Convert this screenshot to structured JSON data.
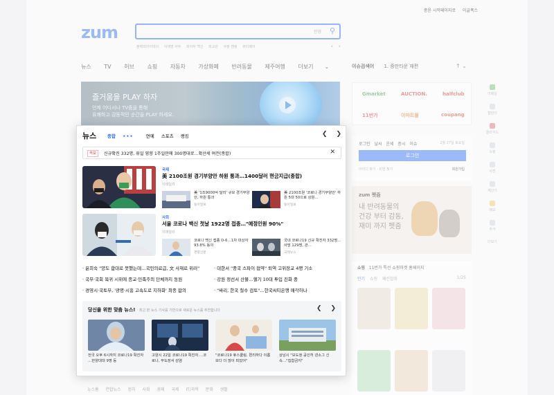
{
  "top_links": [
    "종윤 시작페이지로",
    "이글폭스"
  ],
  "logo": "zum",
  "search": {
    "value": "",
    "kbd": "한영"
  },
  "keywords": [
    "블랙프라이데이",
    "이재명 서부",
    "화이자 백신",
    "외교관",
    "쿠팡 캠핑",
    "뷰티페어"
  ],
  "menu": [
    "뉴스",
    "TV",
    "허브",
    "쇼핑",
    "자동차",
    "가상화폐",
    "반려동물",
    "제주여행",
    "더보기"
  ],
  "issue": {
    "label": "이슈검색어",
    "rank": "1.",
    "term": "중만타운 재편"
  },
  "banner": {
    "title": "즐거움을 PLAY 하자",
    "line1": "언제 어디서나 TV줌을 통해",
    "line2": "유쾌하고 감동적인 순간을 PLAY 하세요."
  },
  "news": {
    "title": "뉴스",
    "tabs": [
      "종합",
      "연예",
      "스포츠",
      "랭킹"
    ],
    "breaking": {
      "badge": "속보",
      "text": "신규확진 332명, 휴일 영향 1주일만에 300명대로…확산세 여전(종합)"
    },
    "stories": [
      {
        "category": "국제",
        "headline": "美 2100조원 경기부양안 하원 통과…1400달러 현금지급(종합)",
        "source": "이데일리",
        "subs": [
          {
            "title": "美 '1조9000억 달러' 규모 경기부양안, 하원 통과",
            "source": "동아일보"
          },
          {
            "title": "美 2100조원 '코로나 경기부양안' 하원 5대 50으로 상원…",
            "source": "동아일보"
          }
        ]
      },
      {
        "category": "사회",
        "headline": "서울 코로나 백신 첫날 1922명 접종…\"예정인원 90%\"",
        "source": "이데일리",
        "subs": [
          {
            "title": "코로나 백신 접종 D-6…1차 대상자 93.8% 동의",
            "source": "경향신문"
          },
          {
            "title": "국내 코로나19 신규 확진자 332명…사망 129명, 관…",
            "source": "국제뉴스"
          }
        ]
      }
    ],
    "list": [
      "윤희숙 \"양도 합대로 못했는데…국민의료급, 文 사재로 위러\"",
      "대한서 \"중국 스파이 협약\" 퇴역 고위장교 4명 기소",
      "국무·국회 복귀 시위에 종교·민족주의 단체까지 동원",
      "강원 정선서 산불…헬기 10대 투입 진화 중",
      "경영시·국토부, '광명·시흥 고속도로 지하화' 최종 합의",
      "\"싸리, 한국 철수 검토\"…한국씨티은행 매각하나"
    ],
    "rec": {
      "title": "당신을 위한 맞춤 뉴스!",
      "desc": "최근 본 뉴스 기사를 기반으로 새로운 뉴스를 추천합니다",
      "cards": [
        "전국 오후 6시까지 코로나19 확진자 …한양대대 9명 등",
        "고양시 22일 코로나19 확진자 …코로나, 무도장서 감염",
        "\"코로나19 휴스쿨링, 편리하다 이롭 보다 더 많이 피았어\"",
        "상남시 \"모도정 공인허 넨소그 신속…\"집합금지\""
      ]
    }
  },
  "subnav": [
    "뉴스홈",
    "연합뉴스",
    "정치",
    "사회",
    "경제",
    "국제",
    "IT/과학",
    "문화",
    "생활"
  ],
  "right": {
    "shops": [
      "Gmarket",
      "AUCTION.",
      "halfclub",
      "11번가",
      "이마트몰",
      "coupang"
    ],
    "login_tabs": [
      "로그인",
      "날씨",
      "운세",
      "증시",
      "이슈"
    ],
    "date": "2월 27일 토요일",
    "login_btn": "로그인",
    "login_small": "아이디 찾기 · 비번 찾기",
    "join": "회원가입",
    "pet_label": "zum 펫줌",
    "pet_text": "내 반려동물의 건강 부터 감동, 재미 까지 펫줌",
    "shop_head": "쇼핑",
    "shop_sub": "11번가 특선 쇼핑마켓 홈페이지",
    "shop_tabs": [
      "인기",
      "쇼핑",
      "패션잡화"
    ],
    "shop_page": "1/25",
    "rail": [
      "이메일",
      "캘린더",
      "클라우드",
      "쇼핑",
      "사전",
      "계산기",
      "메모",
      "추가",
      "더보기"
    ]
  },
  "colors": {
    "accent": "#3b6ff0",
    "logo": "#4f87f5",
    "breaking": "#e23b3b"
  }
}
